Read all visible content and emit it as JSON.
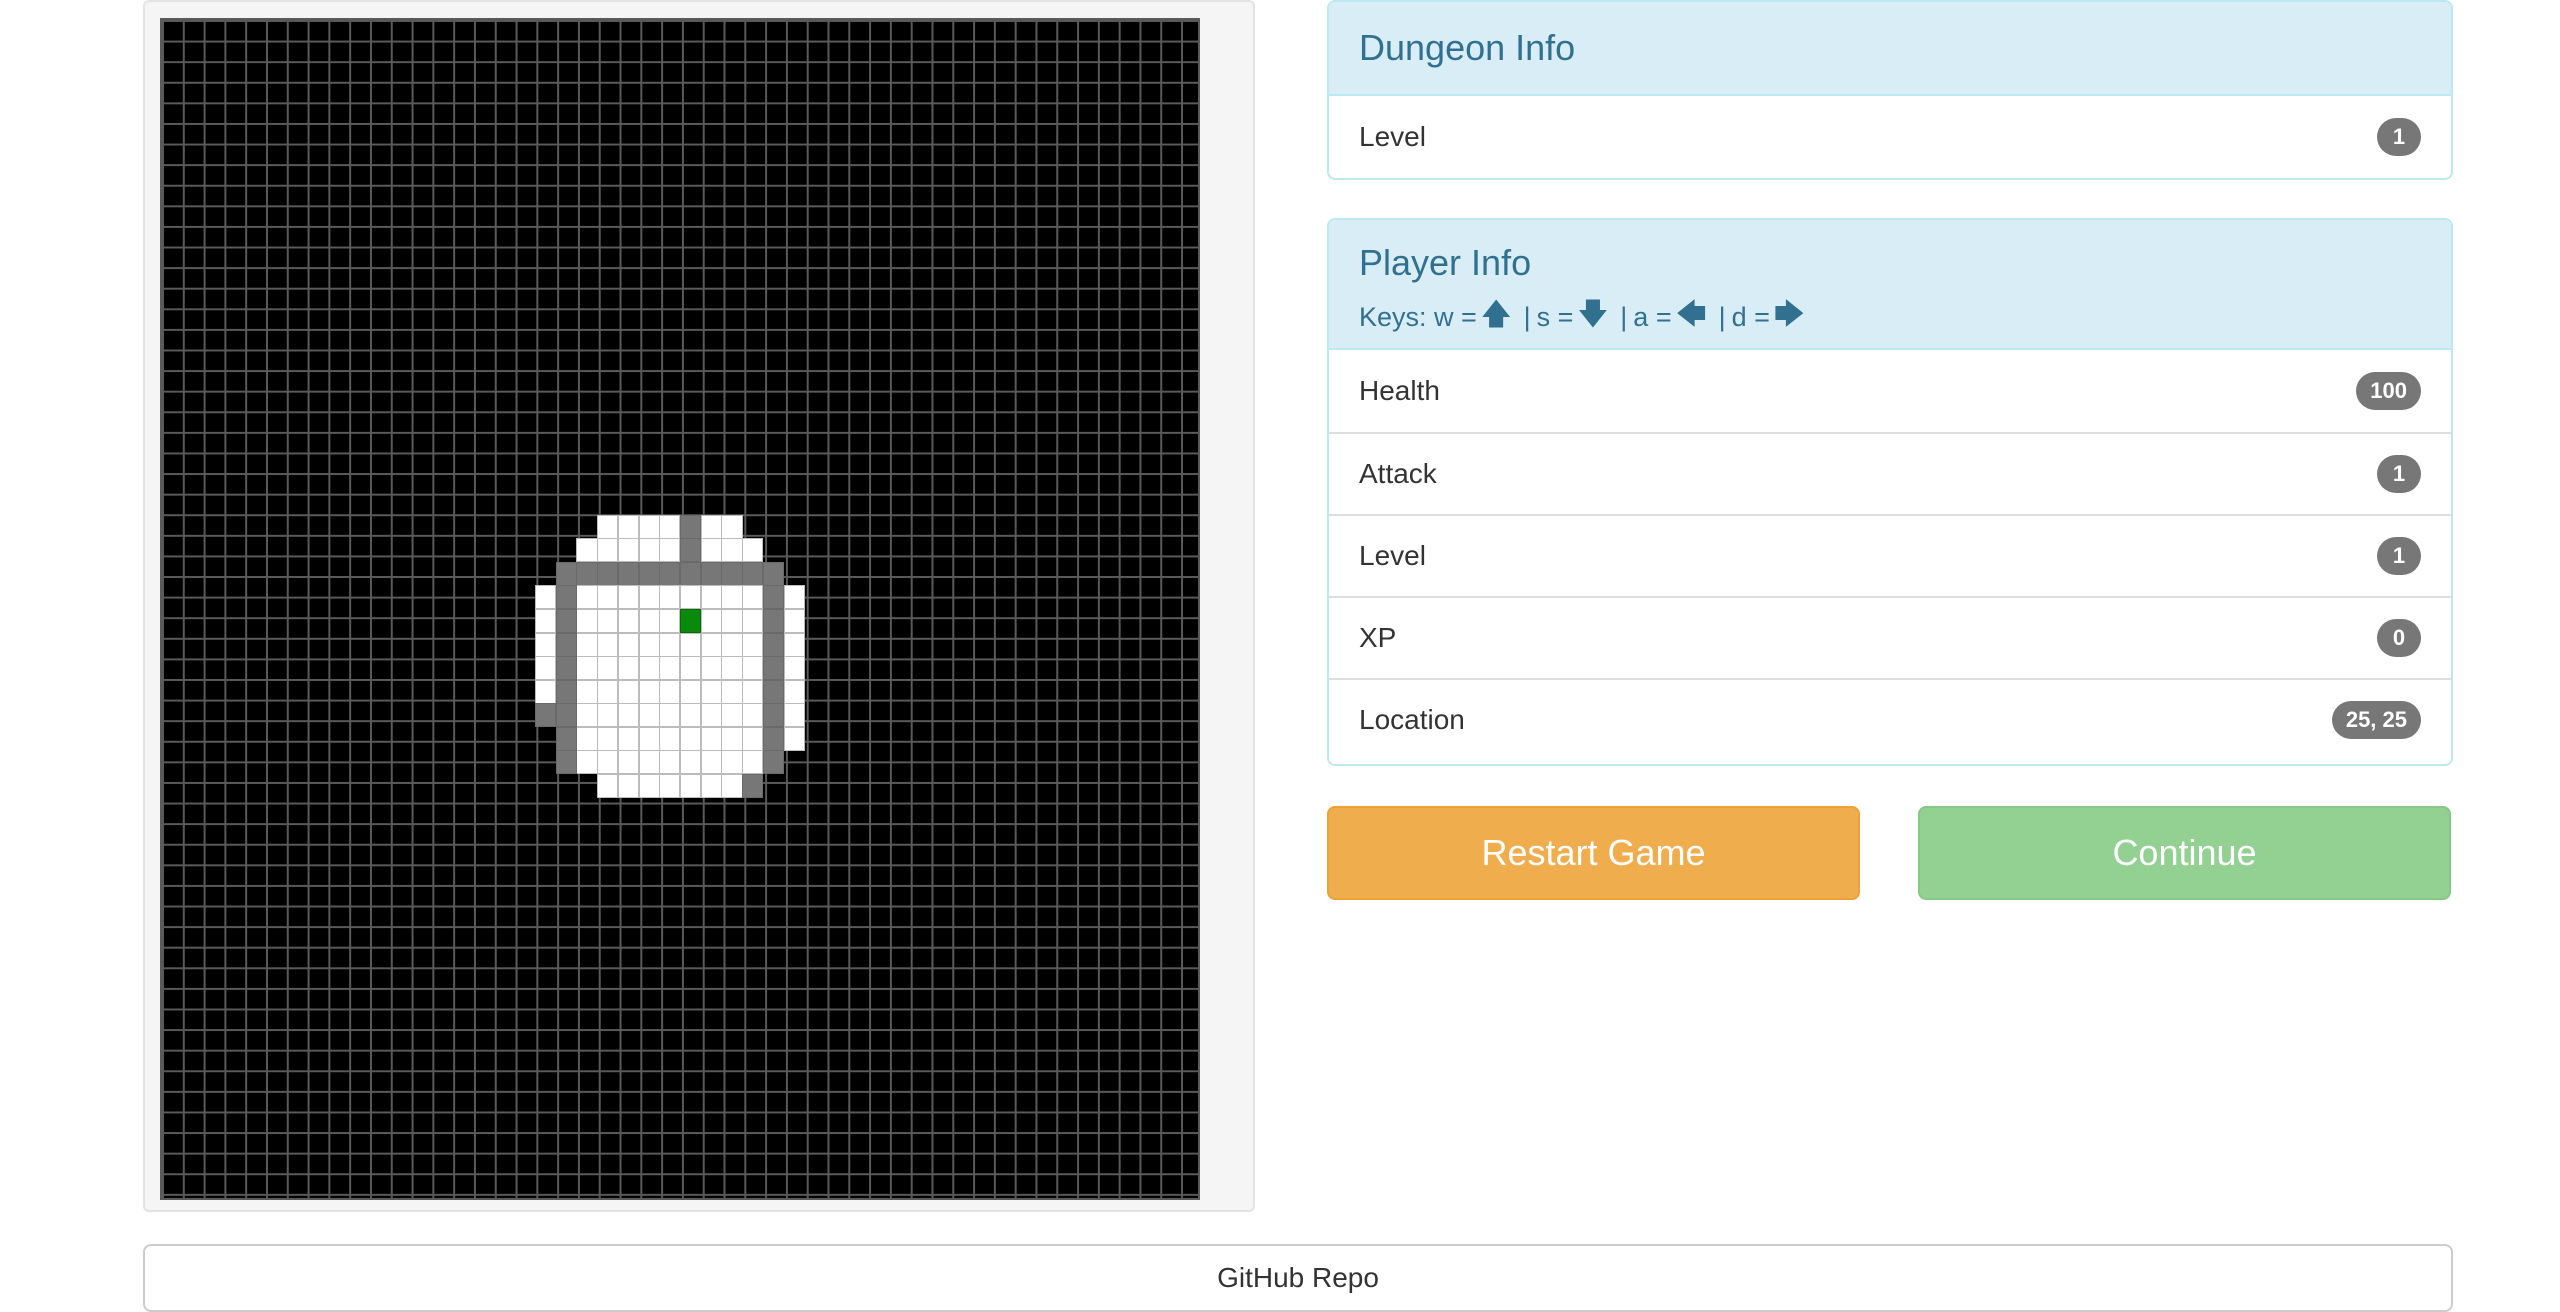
{
  "dungeon_info": {
    "title": "Dungeon Info",
    "stats": [
      {
        "label": "Level",
        "value": "1"
      }
    ]
  },
  "player_info": {
    "title": "Player Info",
    "keys": {
      "prefix": "Keys: w =",
      "s_label": "s =",
      "a_label": "a =",
      "d_label": "d =",
      "separator": "|",
      "up_arrow": "🡅",
      "down_arrow": "🡇",
      "left_arrow": "🡄",
      "right_arrow": "🡆"
    },
    "stats": [
      {
        "label": "Health",
        "value": "100"
      },
      {
        "label": "Attack",
        "value": "1"
      },
      {
        "label": "Level",
        "value": "1"
      },
      {
        "label": "XP",
        "value": "0"
      },
      {
        "label": "Location",
        "value": "25, 25"
      }
    ]
  },
  "buttons": {
    "restart_label": "Restart Game",
    "continue_label": "Continue"
  },
  "footer": {
    "link_label": "GitHub Repo"
  },
  "colors": {
    "floor": "#ffffff",
    "wall": "#777777",
    "fog": "#000000",
    "player": "#0a8a0a",
    "heading_bg": "#d9edf7",
    "heading_text": "#31708f",
    "restart": "#f0ad4e",
    "continue": "#92d192"
  },
  "map": {
    "grid_size": 50,
    "player_location": [
      25,
      25
    ],
    "visible_rows": [
      {
        "row": 21,
        "floor": [
          [
            21,
            24
          ],
          [
            26,
            27
          ]
        ],
        "wall": [
          [
            25,
            25
          ]
        ]
      },
      {
        "row": 22,
        "floor": [
          [
            20,
            24
          ],
          [
            26,
            28
          ]
        ],
        "wall": [
          [
            25,
            25
          ]
        ]
      },
      {
        "row": 23,
        "floor": [],
        "wall": [
          [
            19,
            29
          ]
        ]
      },
      {
        "row": 24,
        "floor": [
          [
            18,
            18
          ],
          [
            20,
            28
          ],
          [
            30,
            30
          ]
        ],
        "wall": [
          [
            19,
            19
          ],
          [
            29,
            29
          ]
        ]
      },
      {
        "row": 25,
        "floor": [
          [
            18,
            18
          ],
          [
            20,
            28
          ],
          [
            30,
            30
          ]
        ],
        "wall": [
          [
            19,
            19
          ],
          [
            29,
            29
          ]
        ]
      },
      {
        "row": 26,
        "floor": [
          [
            18,
            18
          ],
          [
            20,
            28
          ],
          [
            30,
            30
          ]
        ],
        "wall": [
          [
            19,
            19
          ],
          [
            29,
            29
          ]
        ]
      },
      {
        "row": 27,
        "floor": [
          [
            18,
            18
          ],
          [
            20,
            28
          ],
          [
            30,
            30
          ]
        ],
        "wall": [
          [
            19,
            19
          ],
          [
            29,
            29
          ]
        ]
      },
      {
        "row": 28,
        "floor": [
          [
            18,
            18
          ],
          [
            20,
            28
          ],
          [
            30,
            30
          ]
        ],
        "wall": [
          [
            19,
            19
          ],
          [
            29,
            29
          ]
        ]
      },
      {
        "row": 29,
        "floor": [
          [
            20,
            28
          ],
          [
            30,
            30
          ]
        ],
        "wall": [
          [
            18,
            19
          ],
          [
            29,
            29
          ]
        ]
      },
      {
        "row": 30,
        "floor": [
          [
            20,
            28
          ],
          [
            30,
            30
          ]
        ],
        "wall": [
          [
            19,
            19
          ],
          [
            29,
            29
          ]
        ]
      },
      {
        "row": 31,
        "floor": [
          [
            20,
            28
          ]
        ],
        "wall": [
          [
            19,
            19
          ],
          [
            29,
            29
          ]
        ]
      },
      {
        "row": 32,
        "floor": [
          [
            21,
            27
          ]
        ],
        "wall": [
          [
            28,
            28
          ]
        ]
      }
    ]
  }
}
